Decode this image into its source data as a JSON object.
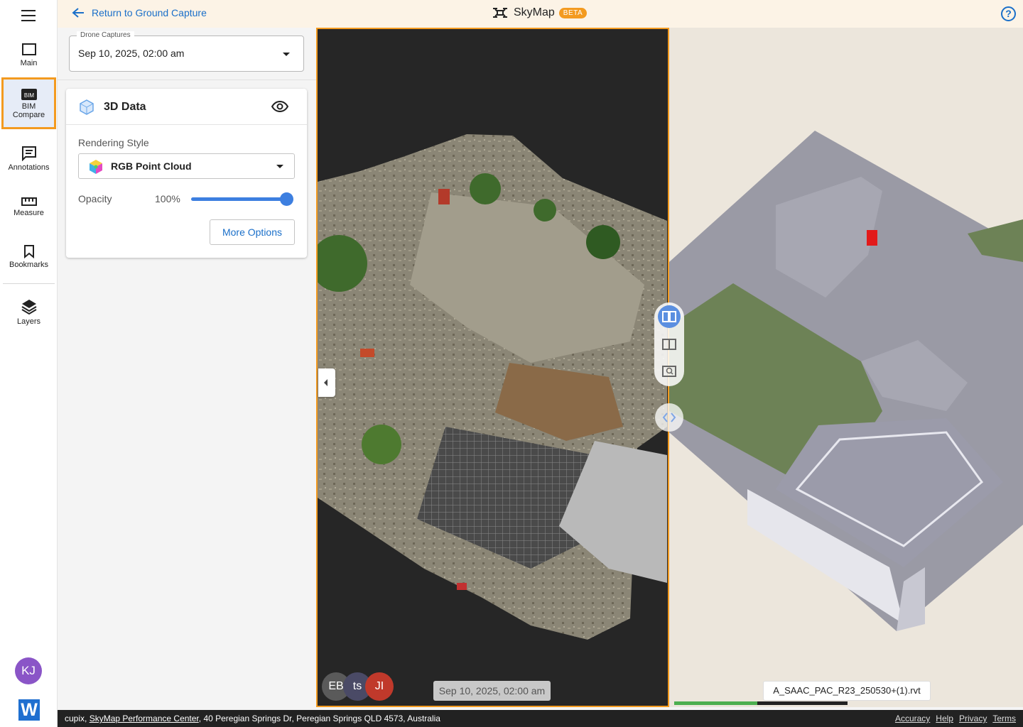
{
  "rail": {
    "items": [
      {
        "label": "Main",
        "icon": "main-view-icon"
      },
      {
        "label": "BIM Compare",
        "line1": "BIM",
        "line2": "Compare",
        "icon": "bim-compare-icon",
        "badge": "BIM",
        "active": true
      },
      {
        "label": "Annotations",
        "icon": "annotations-icon"
      },
      {
        "label": "Measure",
        "icon": "ruler-icon"
      },
      {
        "label": "Bookmarks",
        "icon": "bookmark-icon"
      },
      {
        "label": "Layers",
        "icon": "layers-icon"
      }
    ],
    "user_initials": "KJ",
    "logo_letter": "W"
  },
  "topbar": {
    "back_label": "Return to Ground Capture",
    "app_name": "SkyMap",
    "badge": "BETA",
    "help": "?"
  },
  "drone": {
    "legend": "Drone Captures",
    "value": "Sep 10, 2025, 02:00 am"
  },
  "data_card": {
    "title": "3D Data",
    "rendering_label": "Rendering Style",
    "rendering_value": "RGB Point Cloud",
    "opacity_label": "Opacity",
    "opacity_value": "100%",
    "opacity_level": 1.0,
    "more_options": "More Options"
  },
  "viewer": {
    "capture_date": "Sep 10, 2025, 02:00 am",
    "users": [
      {
        "initials": "EB",
        "color": "#5a5a5a"
      },
      {
        "initials": "ts",
        "color": "#4a4a66"
      },
      {
        "initials": "JI",
        "color": "#c0392b"
      }
    ],
    "bim_file": "A_SAAC_PAC_R23_250530+(1).rvt",
    "load_progress": 0.48
  },
  "statusbar": {
    "org": "cupix",
    "site_link": "SkyMap Performance Center",
    "address": "40 Peregian Springs Dr, Peregian Springs QLD 4573, Australia",
    "links": [
      "Accuracy",
      "Help",
      "Privacy",
      "Terms"
    ]
  },
  "colors": {
    "accent": "#f39a1f",
    "link": "#1a6fc9",
    "slider": "#3d7fe0"
  }
}
